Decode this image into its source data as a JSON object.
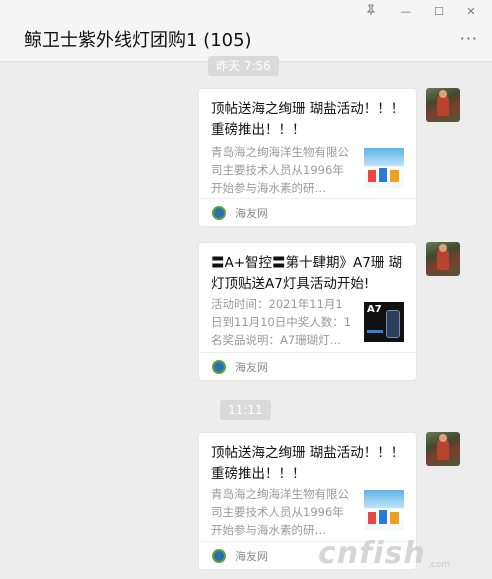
{
  "window": {
    "pin_icon": "pin-icon",
    "min_label": "—",
    "max_label": "☐",
    "close_label": "✕"
  },
  "chat": {
    "title": "鲸卫士紫外线灯团购1 (105)",
    "more_label": "···"
  },
  "timestamps": [
    "昨天 7:56",
    "11:11"
  ],
  "messages": [
    {
      "title": "顶帖送海之绚珊 瑚盐活动！！！ 重磅推出！！！",
      "desc": "青岛海之绚海洋生物有限公司主要技术人员从1996年开始参与海水素的研…",
      "thumb": "ocean-products-thumbnail",
      "source": "海友网"
    },
    {
      "title": "〓A+智控〓第十肆期》A7珊 瑚灯顶贴送A7灯具活动开始!",
      "desc": "活动时间：2021年11月1日到11月10日中奖人数：1名奖品说明：A7珊瑚灯…",
      "thumb_label": "A7",
      "source": "海友网"
    },
    {
      "title": "顶帖送海之绚珊 瑚盐活动！！！ 重磅推出！！！",
      "desc": "青岛海之绚海洋生物有限公司主要技术人员从1996年开始参与海水素的研…",
      "thumb": "ocean-products-thumbnail",
      "source": "海友网"
    }
  ],
  "watermark": {
    "text": "cnfish",
    "sub": ".com"
  }
}
